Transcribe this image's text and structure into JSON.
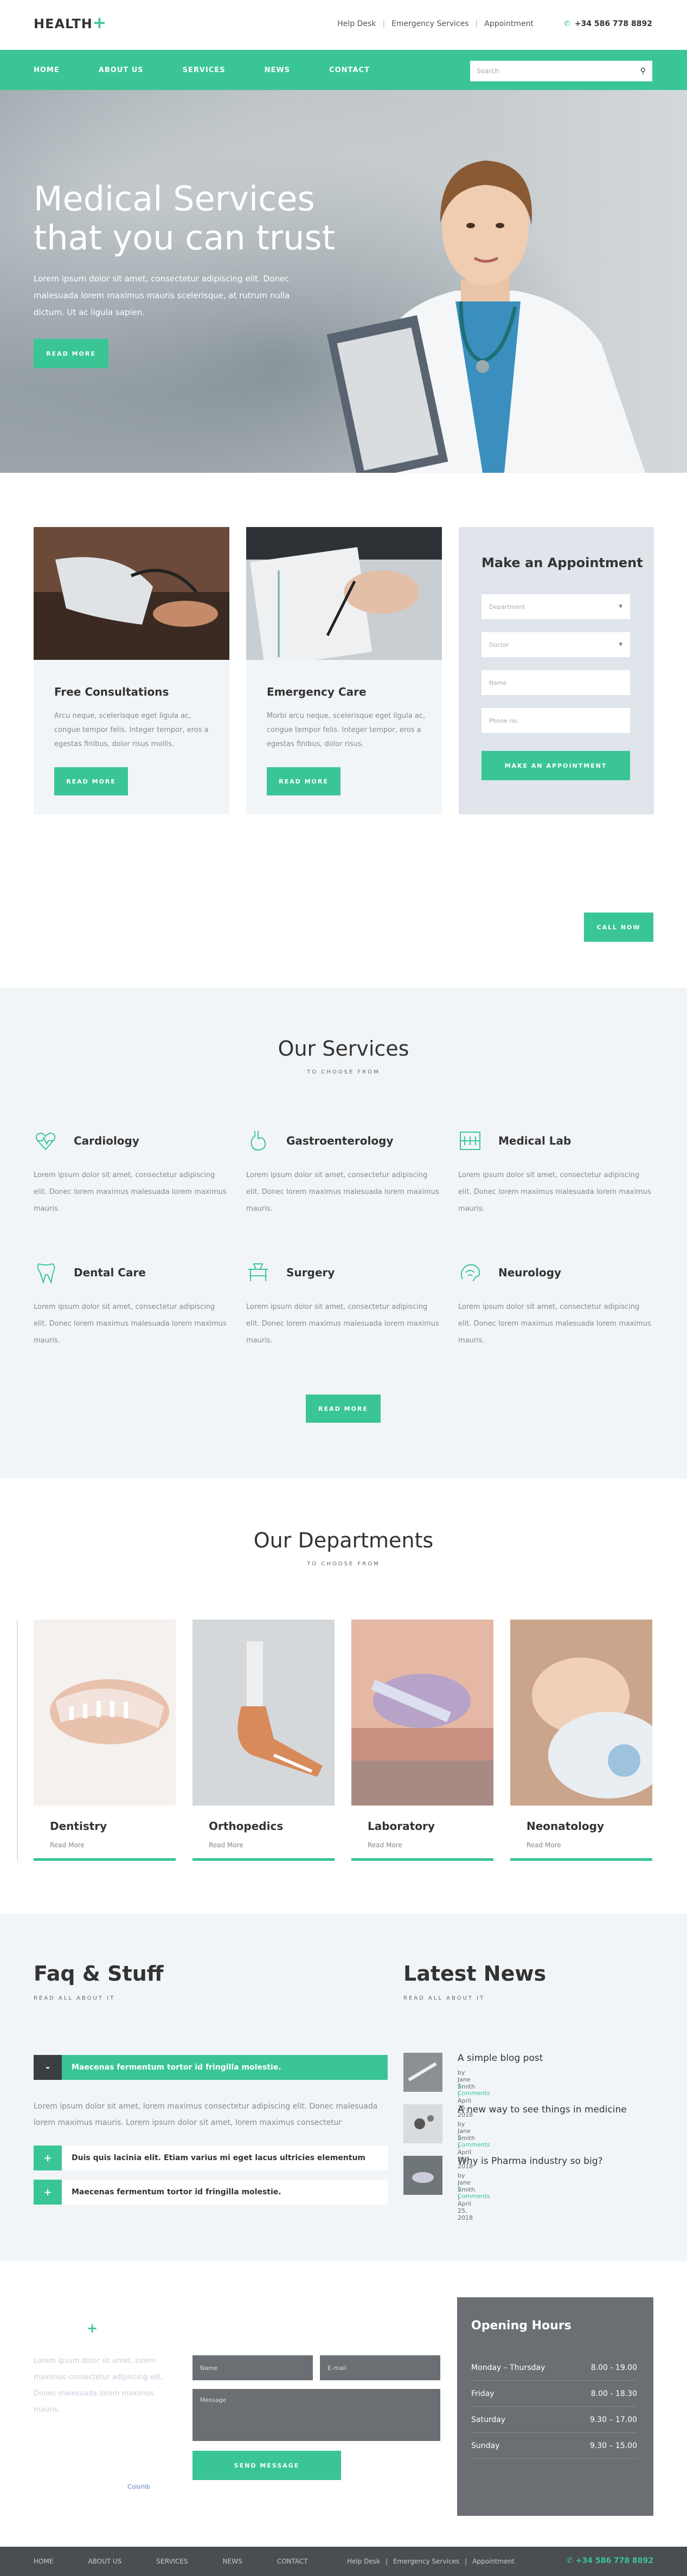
{
  "header": {
    "logo_text": "HEALTH",
    "logo_plus": "+",
    "links": [
      "Help Desk",
      "Emergency Services",
      "Appointment"
    ],
    "phone_icon": "phone-icon",
    "phone": "+34 586 778 8892"
  },
  "nav": {
    "items": [
      "HOME",
      "ABOUT US",
      "SERVICES",
      "NEWS",
      "CONTACT"
    ],
    "search_placeholder": "Search",
    "search_icon": "search-icon"
  },
  "hero": {
    "title": "Medical Services that you can trust",
    "text": "Lorem ipsum dolor sit amet, consectetur adipiscing elit. Donec malesuada lorem maximus mauris scelerisque, at rutrum nulla dictum. Ut ac ligula sapien.",
    "button": "READ MORE"
  },
  "cards": [
    {
      "title": "Free Consultations",
      "text": "Arcu neque, scelerisque eget ligula ac, congue tempor felis. Integer tempor, eros a egestas finibus, dolor risus mollis.",
      "button": "READ MORE"
    },
    {
      "title": "Emergency Care",
      "text": "Morbi arcu neque, scelerisque eget ligula ac, congue tempor felis. Integer tempor, eros a egestas finibus, dolor risus.",
      "button": "READ MORE"
    }
  ],
  "appointment": {
    "title": "Make an Appointment",
    "department": "Department",
    "doctor": "Doctor",
    "name_placeholder": "Name",
    "phone_placeholder": "Phone no.",
    "button": "MAKE AN APPOINTMENT"
  },
  "call_now": "CALL NOW",
  "services": {
    "title": "Our Services",
    "subtitle": "TO CHOOSE FROM",
    "items": [
      {
        "name": "Cardiology",
        "icon": "heart-pulse-icon",
        "text": "Lorem ipsum dolor sit amet, consectetur adipiscing elit. Donec lorem maximus malesuada lorem maximus mauris."
      },
      {
        "name": "Gastroenterology",
        "icon": "stomach-icon",
        "text": "Lorem ipsum dolor sit amet, consectetur adipiscing elit. Donec lorem maximus malesuada lorem maximus mauris."
      },
      {
        "name": "Medical Lab",
        "icon": "microscope-icon",
        "text": "Lorem ipsum dolor sit amet, consectetur adipiscing elit. Donec lorem maximus malesuada lorem maximus mauris."
      },
      {
        "name": "Dental Care",
        "icon": "tooth-icon",
        "text": "Lorem ipsum dolor sit amet, consectetur adipiscing elit. Donec lorem maximus malesuada lorem maximus mauris."
      },
      {
        "name": "Surgery",
        "icon": "operating-table-icon",
        "text": "Lorem ipsum dolor sit amet, consectetur adipiscing elit. Donec lorem maximus malesuada lorem maximus mauris."
      },
      {
        "name": "Neurology",
        "icon": "brain-icon",
        "text": "Lorem ipsum dolor sit amet, consectetur adipiscing elit. Donec lorem maximus malesuada lorem maximus mauris."
      }
    ],
    "button": "READ MORE"
  },
  "departments": {
    "title": "Our Departments",
    "subtitle": "TO CHOOSE FROM",
    "items": [
      {
        "name": "Dentistry",
        "link": "Read More"
      },
      {
        "name": "Orthopedics",
        "link": "Read More"
      },
      {
        "name": "Laboratory",
        "link": "Read More"
      },
      {
        "name": "Neonatology",
        "link": "Read More"
      }
    ]
  },
  "faq": {
    "title": "Faq & Stuff",
    "subtitle": "READ ALL ABOUT IT",
    "items": [
      {
        "sign": "-",
        "question": "Maecenas fermentum tortor id fringilla molestie."
      },
      {
        "sign": "+",
        "question": "Duis quis lacinia elit. Etiam varius mi eget lacus ultricies elementum"
      },
      {
        "sign": "+",
        "question": "Maecenas fermentum tortor id fringilla molestie."
      }
    ],
    "answer": "Lorem ipsum dolor sit amet, lorem maximus consectetur adipiscing elit. Donec malesuada lorem maximus mauris. Lorem ipsum dolor sit amet, lorem maximus consectetur"
  },
  "news": {
    "title": "Latest News",
    "subtitle": "READ ALL ABOUT IT",
    "items": [
      {
        "title": "A simple blog post",
        "meta": "by Jane Smith | April 25, 2018",
        "comments": "2 Comments"
      },
      {
        "title": "A new way to see things in medicine",
        "meta": "by Jane Smith | April 25, 2018",
        "comments": "2 Comments"
      },
      {
        "title": "Why is Pharma industry so big?",
        "meta": "by Jane Smith | April 25, 2018",
        "comments": "2 Comments"
      }
    ]
  },
  "contact": {
    "plus": "+",
    "text": "Lorem ipsum dolor sit amet, lorem maximus consectetur adipiscing elit. Donec malesuada lorem maximus mauris.",
    "name_placeholder": "Name",
    "email_placeholder": "E-mail",
    "message_placeholder": "Message",
    "button": "SEND MESSAGE",
    "credit": "Colorlib"
  },
  "hours": {
    "title": "Opening Hours",
    "rows": [
      {
        "day": "Monday – Thursday",
        "time": "8.00 - 19.00"
      },
      {
        "day": "Friday",
        "time": "8.00 - 18.30"
      },
      {
        "day": "Saturday",
        "time": "9.30 – 17.00"
      },
      {
        "day": "Sunday",
        "time": "9.30 – 15.00"
      }
    ]
  },
  "footer": {
    "nav": [
      "HOME",
      "ABOUT US",
      "SERVICES",
      "NEWS",
      "CONTACT"
    ],
    "links": [
      "Help Desk",
      "Emergency Services",
      "Appointment"
    ],
    "phone": "+34 586 778 8892"
  },
  "colors": {
    "accent": "#3ac596",
    "dark": "#3a3f44",
    "panel": "#f2f5f8"
  }
}
